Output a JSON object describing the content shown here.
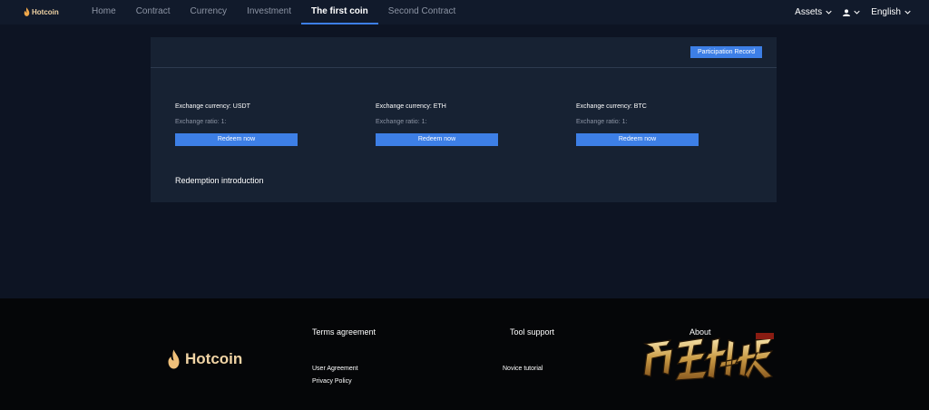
{
  "brand": {
    "name": "Hotcoin",
    "color": "#f0d3a4"
  },
  "nav": {
    "items": [
      {
        "label": "Home",
        "active": false
      },
      {
        "label": "Contract",
        "active": false
      },
      {
        "label": "Currency",
        "active": false
      },
      {
        "label": "Investment",
        "active": false
      },
      {
        "label": "The first coin",
        "active": true
      },
      {
        "label": "Second Contract",
        "active": false
      }
    ],
    "assets_label": "Assets",
    "language_label": "English"
  },
  "card": {
    "record_button": "Participation Record",
    "columns": [
      {
        "currency": "Exchange currency: USDT",
        "ratio": "Exchange ratio: 1:",
        "button": "Redeem now"
      },
      {
        "currency": "Exchange currency: ETH",
        "ratio": "Exchange ratio: 1:",
        "button": "Redeem now"
      },
      {
        "currency": "Exchange currency: BTC",
        "ratio": "Exchange ratio: 1:",
        "button": "Redeem now"
      }
    ],
    "intro_title": "Redemption introduction"
  },
  "footer": {
    "terms_heading": "Terms agreement",
    "tool_heading": "Tool support",
    "about_heading": "About",
    "user_agreement": "User Agreement",
    "privacy_policy": "Privacy Policy",
    "novice_tutorial": "Novice tutorial"
  },
  "colors": {
    "accent": "#3d7fe6",
    "background": "#0d1423",
    "card": "#172233",
    "footer": "#050608"
  }
}
